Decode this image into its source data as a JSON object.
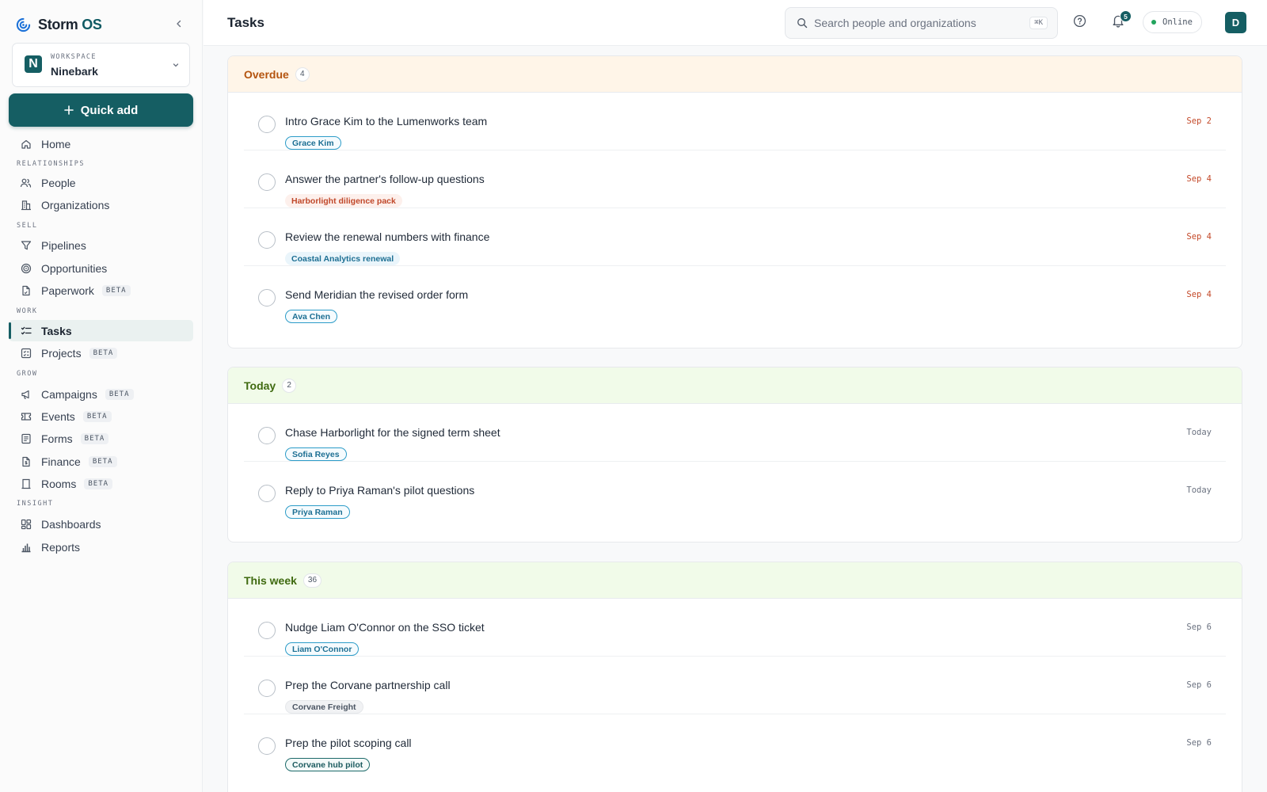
{
  "app": {
    "name_main": "Storm",
    "name_suffix": "OS"
  },
  "workspace": {
    "label": "WORKSPACE",
    "name": "Ninebark",
    "initial": "N"
  },
  "quick_add": {
    "label": "Quick add"
  },
  "nav": {
    "home": "Home",
    "sections": {
      "relationships": "RELATIONSHIPS",
      "sell": "SELL",
      "work": "WORK",
      "grow": "GROW",
      "insight": "INSIGHT"
    },
    "people": "People",
    "organizations": "Organizations",
    "pipelines": "Pipelines",
    "opportunities": "Opportunities",
    "paperwork": "Paperwork",
    "tasks": "Tasks",
    "projects": "Projects",
    "campaigns": "Campaigns",
    "events": "Events",
    "forms": "Forms",
    "finance": "Finance",
    "rooms": "Rooms",
    "dashboards": "Dashboards",
    "reports": "Reports",
    "beta": "BETA"
  },
  "header": {
    "title": "Tasks",
    "search_placeholder": "Search people and organizations",
    "search_shortcut": "⌘K",
    "notifications_count": "5",
    "status": "Online",
    "avatar_initial": "D"
  },
  "groups": {
    "overdue": {
      "title": "Overdue",
      "count": "4",
      "tasks": [
        {
          "title": "Intro Grace Kim to the Lumenworks team",
          "tag": "Grace Kim",
          "date": "Sep 2"
        },
        {
          "title": "Answer the partner's follow-up questions",
          "tag": "Harborlight diligence pack",
          "date": "Sep 4"
        },
        {
          "title": "Review the renewal numbers with finance",
          "tag": "Coastal Analytics renewal",
          "date": "Sep 4"
        },
        {
          "title": "Send Meridian the revised order form",
          "tag": "Ava Chen",
          "date": "Sep 4"
        }
      ]
    },
    "today": {
      "title": "Today",
      "count": "2",
      "tasks": [
        {
          "title": "Chase Harborlight for the signed term sheet",
          "tag": "Sofia Reyes",
          "date": "Today"
        },
        {
          "title": "Reply to Priya Raman's pilot questions",
          "tag": "Priya Raman",
          "date": "Today"
        }
      ]
    },
    "week": {
      "title": "This week",
      "count": "36",
      "tasks": [
        {
          "title": "Nudge Liam O'Connor on the SSO ticket",
          "tag": "Liam O'Connor",
          "date": "Sep 6"
        },
        {
          "title": "Prep the Corvane partnership call",
          "tag": "Corvane Freight",
          "date": "Sep 6"
        },
        {
          "title": "Prep the pilot scoping call",
          "tag": "Corvane hub pilot",
          "date": "Sep 6"
        }
      ]
    }
  },
  "colors": {
    "brand": "#155e63",
    "overdue": "#c44a2a",
    "today": "#3f6a10"
  }
}
